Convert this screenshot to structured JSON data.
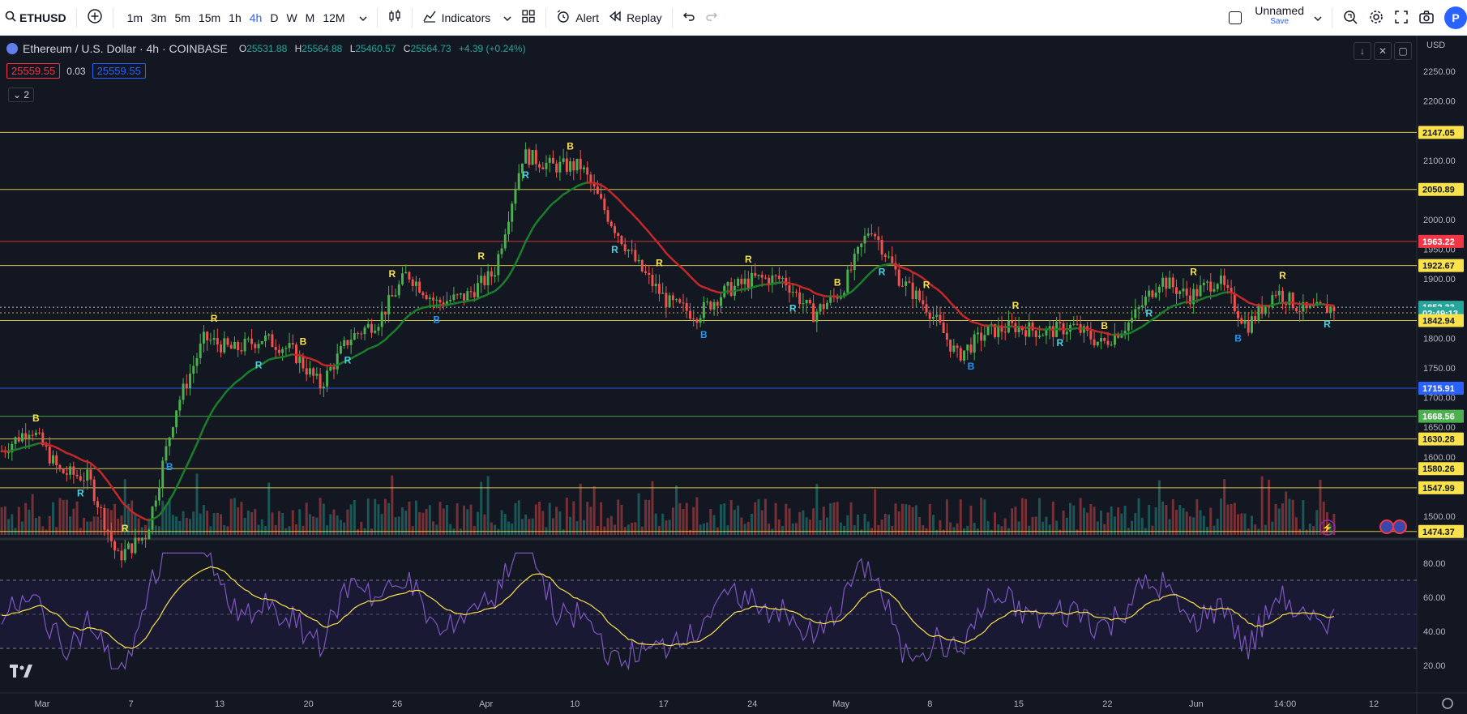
{
  "toolbar": {
    "symbol": "ETHUSD",
    "timeframes": [
      "1m",
      "3m",
      "5m",
      "15m",
      "1h",
      "4h",
      "D",
      "W",
      "M",
      "12M"
    ],
    "active_timeframe": "4h",
    "indicators_label": "Indicators",
    "alert_label": "Alert",
    "replay_label": "Replay",
    "layout_name": "Unnamed",
    "layout_save": "Save",
    "avatar_letter": "P"
  },
  "legend": {
    "title": "Ethereum / U.S. Dollar · 4h · COINBASE",
    "o_label": "O",
    "o_value": "25531.88",
    "h_label": "H",
    "h_value": "25564.88",
    "l_label": "L",
    "l_value": "25460.57",
    "c_label": "C",
    "c_value": "25564.73",
    "change": "+4.39 (+0.24%)",
    "sell_price": "25559.55",
    "spread": "0.03",
    "buy_price": "25559.55",
    "collapse_count": "2"
  },
  "price_axis": {
    "currency": "USD",
    "ticks": [
      "2250.00",
      "2200.00",
      "2150.00",
      "2100.00",
      "2050.00",
      "2000.00",
      "1950.00",
      "1900.00",
      "1850.00",
      "1800.00",
      "1750.00",
      "1700.00",
      "1650.00",
      "1600.00",
      "1550.00",
      "1500.00"
    ],
    "labels": [
      {
        "text": "2147.05",
        "color": "#f9e24b",
        "price": 2147.05
      },
      {
        "text": "2050.89",
        "color": "#f9e24b",
        "price": 2050.89
      },
      {
        "text": "1963.22",
        "color": "#f23645",
        "price": 1963.22
      },
      {
        "text": "1922.67",
        "color": "#f9e24b",
        "price": 1922.67
      },
      {
        "text": "1852.33",
        "color": "#26a69a",
        "price": 1852.33
      },
      {
        "text": "02:49:13",
        "color": "#26a69a",
        "price": 1842.0
      },
      {
        "text": "1842.94",
        "color": "#f9e24b",
        "price": 1830.0
      },
      {
        "text": "1715.91",
        "color": "#2962ff",
        "price": 1715.91
      },
      {
        "text": "1668.56",
        "color": "#4caf50",
        "price": 1668.56
      },
      {
        "text": "1630.28",
        "color": "#f9e24b",
        "price": 1630.28
      },
      {
        "text": "1580.26",
        "color": "#f9e24b",
        "price": 1580.26
      },
      {
        "text": "1547.99",
        "color": "#f9e24b",
        "price": 1547.99
      },
      {
        "text": "1474.37",
        "color": "#f9e24b",
        "price": 1474.37
      }
    ]
  },
  "rsi_axis": {
    "ticks": [
      "80.00",
      "60.00",
      "40.00",
      "20.00"
    ]
  },
  "time_axis": {
    "labels": [
      "Mar",
      "7",
      "13",
      "20",
      "26",
      "Apr",
      "10",
      "17",
      "24",
      "May",
      "8",
      "15",
      "22",
      "Jun",
      "14:00",
      "12"
    ]
  },
  "chart_data": {
    "type": "candlestick",
    "symbol": "ETHUSD",
    "exchange": "COINBASE",
    "interval": "4h",
    "ylim": [
      1470,
      2270
    ],
    "horizontal_levels": [
      2147.05,
      2050.89,
      1963.22,
      1922.67,
      1842.94,
      1715.91,
      1668.56,
      1630.28,
      1580.26,
      1547.99,
      1474.37
    ],
    "last_price": 1852.33,
    "price_path": [
      {
        "t": "Feb 27",
        "p": 1610
      },
      {
        "t": "Mar 1",
        "p": 1650
      },
      {
        "t": "Mar 3",
        "p": 1575
      },
      {
        "t": "Mar 7",
        "p": 1565
      },
      {
        "t": "Mar 10",
        "p": 1430
      },
      {
        "t": "Mar 12",
        "p": 1470
      },
      {
        "t": "Mar 13",
        "p": 1680
      },
      {
        "t": "Mar 17",
        "p": 1800
      },
      {
        "t": "Mar 20",
        "p": 1780
      },
      {
        "t": "Mar 22",
        "p": 1800
      },
      {
        "t": "Mar 25",
        "p": 1780
      },
      {
        "t": "Mar 28",
        "p": 1720
      },
      {
        "t": "Mar 31",
        "p": 1800
      },
      {
        "t": "Apr 3",
        "p": 1830
      },
      {
        "t": "Apr 5",
        "p": 1910
      },
      {
        "t": "Apr 8",
        "p": 1860
      },
      {
        "t": "Apr 10",
        "p": 1870
      },
      {
        "t": "Apr 12",
        "p": 1910
      },
      {
        "t": "Apr 14",
        "p": 2110
      },
      {
        "t": "Apr 16",
        "p": 2090
      },
      {
        "t": "Apr 18",
        "p": 2090
      },
      {
        "t": "Apr 19",
        "p": 2000
      },
      {
        "t": "Apr 21",
        "p": 1920
      },
      {
        "t": "Apr 22",
        "p": 1860
      },
      {
        "t": "Apr 24",
        "p": 1840
      },
      {
        "t": "Apr 26",
        "p": 1880
      },
      {
        "t": "Apr 27",
        "p": 1900
      },
      {
        "t": "Apr 29",
        "p": 1900
      },
      {
        "t": "May 1",
        "p": 1840
      },
      {
        "t": "May 3",
        "p": 1880
      },
      {
        "t": "May 5",
        "p": 1990
      },
      {
        "t": "May 7",
        "p": 1900
      },
      {
        "t": "May 9",
        "p": 1850
      },
      {
        "t": "May 11",
        "p": 1770
      },
      {
        "t": "May 13",
        "p": 1810
      },
      {
        "t": "May 16",
        "p": 1820
      },
      {
        "t": "May 19",
        "p": 1810
      },
      {
        "t": "May 22",
        "p": 1820
      },
      {
        "t": "May 24",
        "p": 1790
      },
      {
        "t": "May 27",
        "p": 1830
      },
      {
        "t": "May 29",
        "p": 1900
      },
      {
        "t": "Jun 1",
        "p": 1870
      },
      {
        "t": "Jun 3",
        "p": 1900
      },
      {
        "t": "Jun 5",
        "p": 1820
      },
      {
        "t": "Jun 6",
        "p": 1880
      },
      {
        "t": "Jun 7",
        "p": 1845
      },
      {
        "t": "Jun 8",
        "p": 1852
      }
    ],
    "rsi": {
      "ylim": [
        10,
        90
      ],
      "upper": 70,
      "middle": 50,
      "lower": 30
    }
  }
}
